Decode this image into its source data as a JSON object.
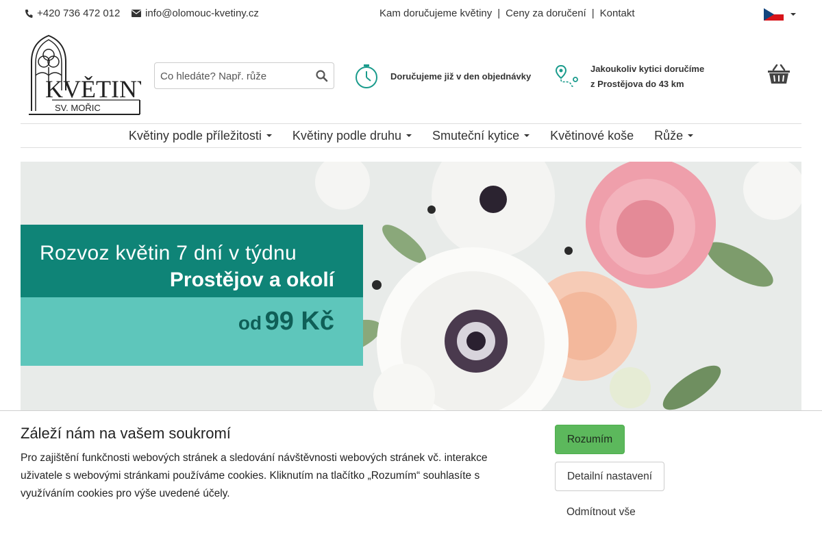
{
  "topbar": {
    "phone": "+420 736 472 012",
    "email": "info@olomouc-kvetiny.cz",
    "links": [
      "Kam doručujeme květiny",
      "Ceny za doručení",
      "Kontakt"
    ],
    "separator": "|",
    "language": "cs"
  },
  "logo": {
    "line1": "KVĚTINY",
    "line2": "SV. MOŘIC"
  },
  "search": {
    "placeholder": "Co hledáte? Např. růže",
    "value": ""
  },
  "info": {
    "delivery_today": "Doručujeme již v den objednávky",
    "area_line1": "Jakoukoliv kytici doručíme",
    "area_line2": "z Prostějova do 43 km"
  },
  "nav": {
    "items": [
      {
        "label": "Květiny podle příležitosti",
        "dropdown": true
      },
      {
        "label": "Květiny podle druhu",
        "dropdown": true
      },
      {
        "label": "Smuteční kytice",
        "dropdown": true
      },
      {
        "label": "Květinové koše",
        "dropdown": false
      },
      {
        "label": "Růže",
        "dropdown": true
      }
    ]
  },
  "hero": {
    "line1": "Rozvoz květin 7 dní v týdnu",
    "line2": "Prostějov a okolí",
    "price_prefix": "od",
    "price": "99 Kč"
  },
  "cookie": {
    "title": "Záleží nám na vašem soukromí",
    "text": "Pro zajištění funkčnosti webových stránek a sledování návštěvnosti webových stránek vč. interakce uživatele s webovými stránkami používáme cookies. Kliknutím na tlačítko „Rozumím“ souhlasíte s využíváním cookies pro výše uvedené účely.",
    "accept": "Rozumím",
    "details": "Detailní nastavení",
    "reject": "Odmítnout vše"
  },
  "colors": {
    "teal_dark": "#0f8477",
    "teal_light": "#5ec6bb",
    "accent_green": "#5cb85c",
    "icon_teal": "#1a9b8c"
  }
}
